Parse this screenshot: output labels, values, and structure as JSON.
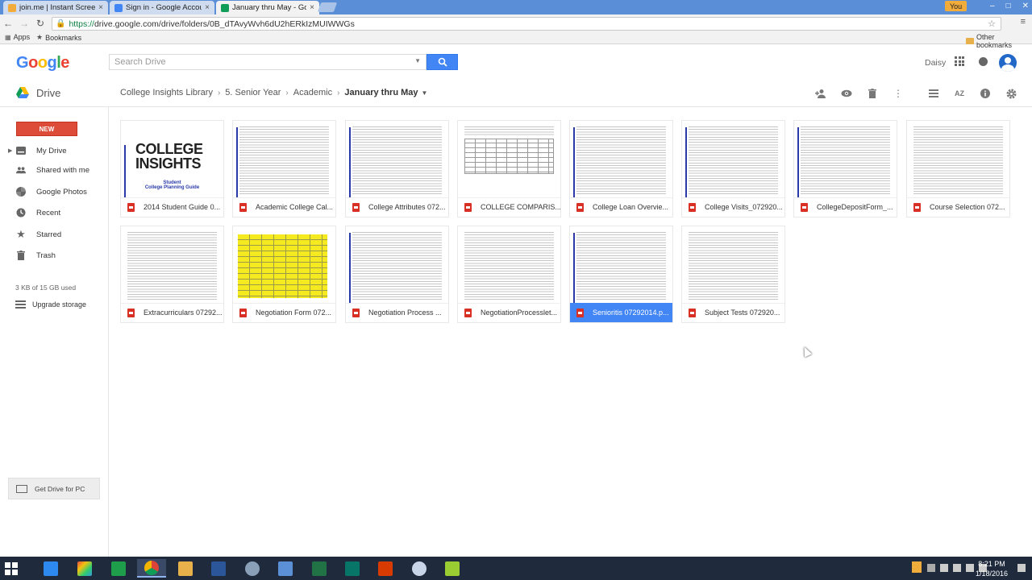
{
  "browser": {
    "tabs": [
      {
        "title": "join.me | Instant Screen Sh",
        "color": "#f2ac3b"
      },
      {
        "title": "Sign in - Google Accounts",
        "color": "#4285f4"
      },
      {
        "title": "January thru May - Google",
        "color": "#0f9d58",
        "active": true
      }
    ],
    "user_badge": "You",
    "url": "https://drive.google.com/drive/folders/0B_dTAvyWvh6dU2hERkIzMUIWWGs",
    "url_scheme": "https://",
    "url_rest": "drive.google.com/drive/folders/0B_dTAvyWvh6dU2hERkIzMUIWWGs",
    "bookmarks": {
      "apps": "Apps",
      "bookmarks": "Bookmarks",
      "other": "Other bookmarks"
    }
  },
  "google": {
    "logo": "Google",
    "search_placeholder": "Search Drive",
    "username": "Daisy"
  },
  "drive": {
    "name": "Drive",
    "breadcrumbs": [
      "College Insights Library",
      "5. Senior Year",
      "Academic"
    ],
    "current_folder": "January thru May"
  },
  "sidebar": {
    "new_label": "NEW",
    "items": [
      {
        "label": "My Drive",
        "icon": "drive-icon"
      },
      {
        "label": "Shared with me",
        "icon": "people-icon"
      },
      {
        "label": "Google Photos",
        "icon": "photos-icon"
      },
      {
        "label": "Recent",
        "icon": "clock-icon"
      },
      {
        "label": "Starred",
        "icon": "star-icon"
      },
      {
        "label": "Trash",
        "icon": "trash-icon"
      }
    ],
    "storage": "3 KB of 15 GB used",
    "upgrade": "Upgrade storage",
    "get_drive": "Get Drive for PC"
  },
  "files": [
    {
      "name": "2014 Student Guide 0...",
      "thumb": "college-insights"
    },
    {
      "name": "Academic College Cal...",
      "thumb": "doc-blue"
    },
    {
      "name": "College Attributes 072...",
      "thumb": "doc-blue"
    },
    {
      "name": "COLLEGE COMPARIS...",
      "thumb": "table"
    },
    {
      "name": "College Loan Overvie...",
      "thumb": "doc-blue"
    },
    {
      "name": "College Visits_072920...",
      "thumb": "doc-blue"
    },
    {
      "name": "CollegeDepositForm_...",
      "thumb": "doc-blue"
    },
    {
      "name": "Course Selection 072...",
      "thumb": "doc"
    },
    {
      "name": "Extracurriculars 07292...",
      "thumb": "doc"
    },
    {
      "name": "Negotiation Form 072...",
      "thumb": "yellow"
    },
    {
      "name": "Negotiation Process ...",
      "thumb": "doc-blue"
    },
    {
      "name": "NegotiationProcesslet...",
      "thumb": "doc"
    },
    {
      "name": "Senioritis 07292014.p...",
      "thumb": "doc-blue",
      "selected": true
    },
    {
      "name": "Subject Tests 072920...",
      "thumb": "doc"
    }
  ],
  "thumb_text": {
    "logo_line1": "COLLEGE",
    "logo_line2": "INSIGHTS",
    "sub1": "Student",
    "sub2": "College Planning Guide"
  },
  "taskbar": {
    "time": "8:21 PM",
    "date": "1/18/2016"
  }
}
